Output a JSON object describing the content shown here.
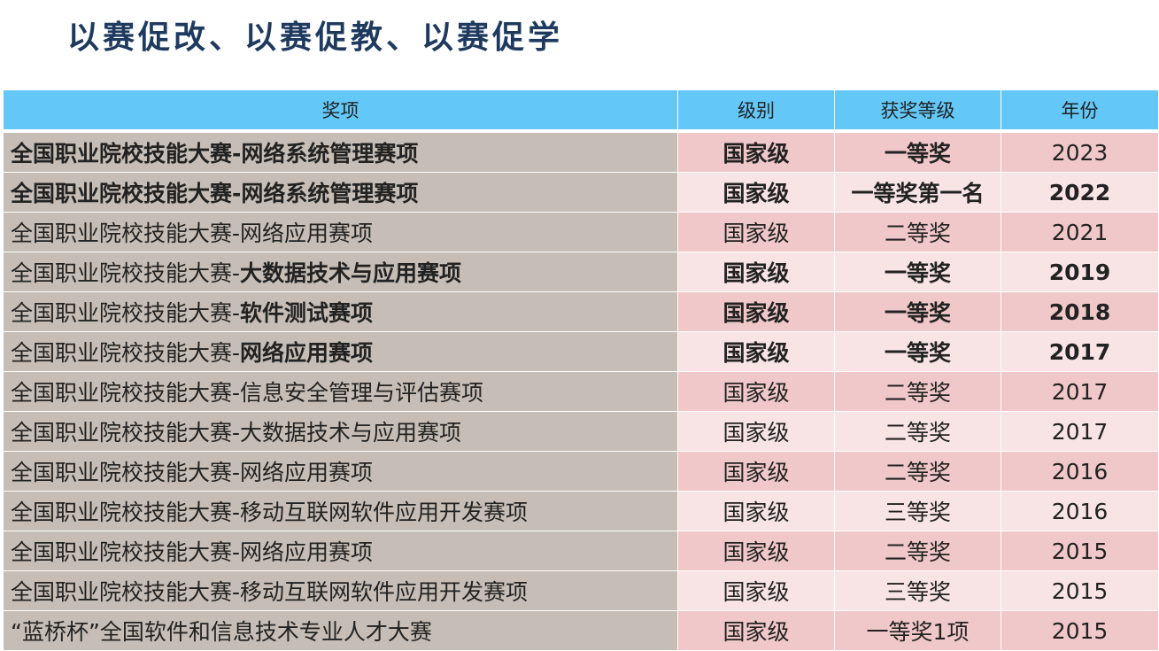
{
  "title": "以赛促改、以赛促教、以赛促学",
  "table": {
    "headers": [
      "奖项",
      "级别",
      "获奖等级",
      "年份"
    ],
    "rows": [
      {
        "prefix": "全国职业院校技能大赛-网络系统管理赛项",
        "event": "",
        "level": "国家级",
        "grade": "一等奖",
        "year": "2023",
        "name_bold": "all",
        "cells_bold": [
          true,
          true,
          false
        ]
      },
      {
        "prefix": "全国职业院校技能大赛-网络系统管理赛项",
        "event": "",
        "level": "国家级",
        "grade": "一等奖第一名",
        "year": "2022",
        "name_bold": "all",
        "cells_bold": [
          true,
          true,
          true
        ]
      },
      {
        "prefix": "全国职业院校技能大赛-网络应用赛项",
        "event": "",
        "level": "国家级",
        "grade": "二等奖",
        "year": "2021",
        "name_bold": "none",
        "cells_bold": [
          false,
          false,
          false
        ]
      },
      {
        "prefix": "全国职业院校技能大赛-",
        "event": "大数据技术与应用赛项",
        "level": "国家级",
        "grade": "一等奖",
        "year": "2019",
        "name_bold": "event",
        "cells_bold": [
          true,
          true,
          true
        ]
      },
      {
        "prefix": "全国职业院校技能大赛-",
        "event": "软件测试赛项",
        "level": "国家级",
        "grade": "一等奖",
        "year": "2018",
        "name_bold": "event",
        "cells_bold": [
          true,
          true,
          true
        ]
      },
      {
        "prefix": "全国职业院校技能大赛-",
        "event": "网络应用赛项",
        "level": "国家级",
        "grade": "一等奖",
        "year": "2017",
        "name_bold": "event",
        "cells_bold": [
          true,
          true,
          true
        ]
      },
      {
        "prefix": "全国职业院校技能大赛-信息安全管理与评估赛项",
        "event": "",
        "level": "国家级",
        "grade": "二等奖",
        "year": "2017",
        "name_bold": "none",
        "cells_bold": [
          false,
          false,
          false
        ]
      },
      {
        "prefix": "全国职业院校技能大赛-大数据技术与应用赛项",
        "event": "",
        "level": "国家级",
        "grade": "二等奖",
        "year": "2017",
        "name_bold": "none",
        "cells_bold": [
          false,
          false,
          false
        ]
      },
      {
        "prefix": "全国职业院校技能大赛-网络应用赛项",
        "event": "",
        "level": "国家级",
        "grade": "二等奖",
        "year": "2016",
        "name_bold": "none",
        "cells_bold": [
          false,
          false,
          false
        ]
      },
      {
        "prefix": "全国职业院校技能大赛-移动互联网软件应用开发赛项",
        "event": "",
        "level": "国家级",
        "grade": "三等奖",
        "year": "2016",
        "name_bold": "none",
        "cells_bold": [
          false,
          false,
          false
        ]
      },
      {
        "prefix": "全国职业院校技能大赛-网络应用赛项",
        "event": "",
        "level": "国家级",
        "grade": "二等奖",
        "year": "2015",
        "name_bold": "none",
        "cells_bold": [
          false,
          false,
          false
        ]
      },
      {
        "prefix": "全国职业院校技能大赛-移动互联网软件应用开发赛项",
        "event": "",
        "level": "国家级",
        "grade": "三等奖",
        "year": "2015",
        "name_bold": "none",
        "cells_bold": [
          false,
          false,
          false
        ]
      },
      {
        "prefix": "“蓝桥杯”全国软件和信息技术专业人才大赛",
        "event": "",
        "level": "国家级",
        "grade": "一等奖1项",
        "year": "2015",
        "name_bold": "none",
        "cells_bold": [
          false,
          false,
          false
        ]
      }
    ]
  },
  "colors": {
    "title": "#1f3a5f",
    "header_bg": "#63c8f8",
    "name_col_bg": "#c5bdb6",
    "row_dark": "#f1c8c9",
    "row_light": "#f8e4e4"
  }
}
